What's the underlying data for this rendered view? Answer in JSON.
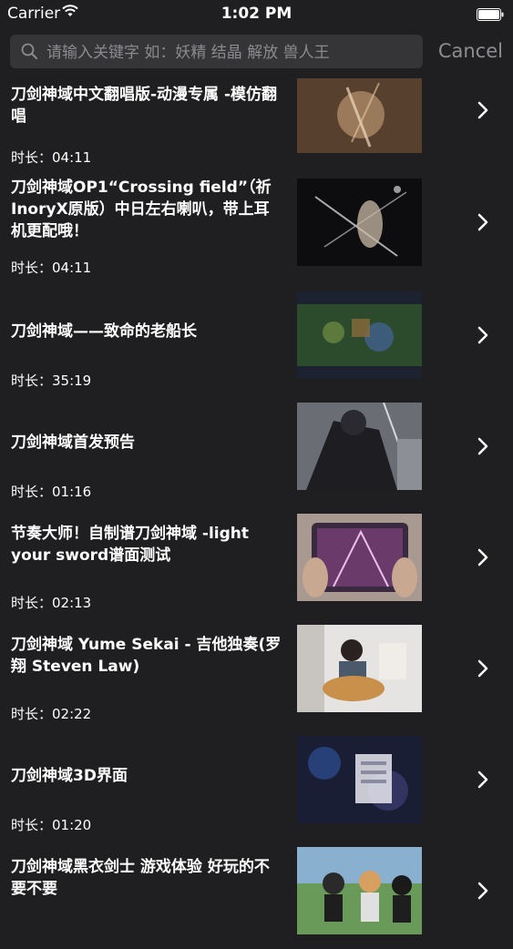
{
  "status_bar": {
    "carrier": "Carrier",
    "time": "1:02 PM"
  },
  "search": {
    "placeholder": "请输入关键字 如：妖精 结晶 解放 兽人王",
    "cancel_label": "Cancel"
  },
  "videos": [
    {
      "title": "刀剑神域中文翻唱版-动漫专属 -模仿翻唱",
      "duration": "时长：04:11"
    },
    {
      "title": "刀剑神域OP1“Crossing field”（祈InoryX原版）中日左右喇叭，带上耳机更配哦！",
      "duration": "时长：04:11"
    },
    {
      "title": "刀剑神域——致命的老船长",
      "duration": "时长：35:19"
    },
    {
      "title": "刀剑神域首发预告",
      "duration": "时长：01:16"
    },
    {
      "title": "节奏大师！自制谱刀剑神域 -light your sword谱面测试",
      "duration": "时长：02:13"
    },
    {
      "title": "刀剑神域 Yume Sekai - 吉他独奏(罗翔 Steven Law)",
      "duration": "时长：02:22"
    },
    {
      "title": "刀剑神域3D界面",
      "duration": "时长：01:20"
    },
    {
      "title": "刀剑神域黑衣剑士 游戏体验 好玩的不要不要",
      "duration": ""
    }
  ]
}
